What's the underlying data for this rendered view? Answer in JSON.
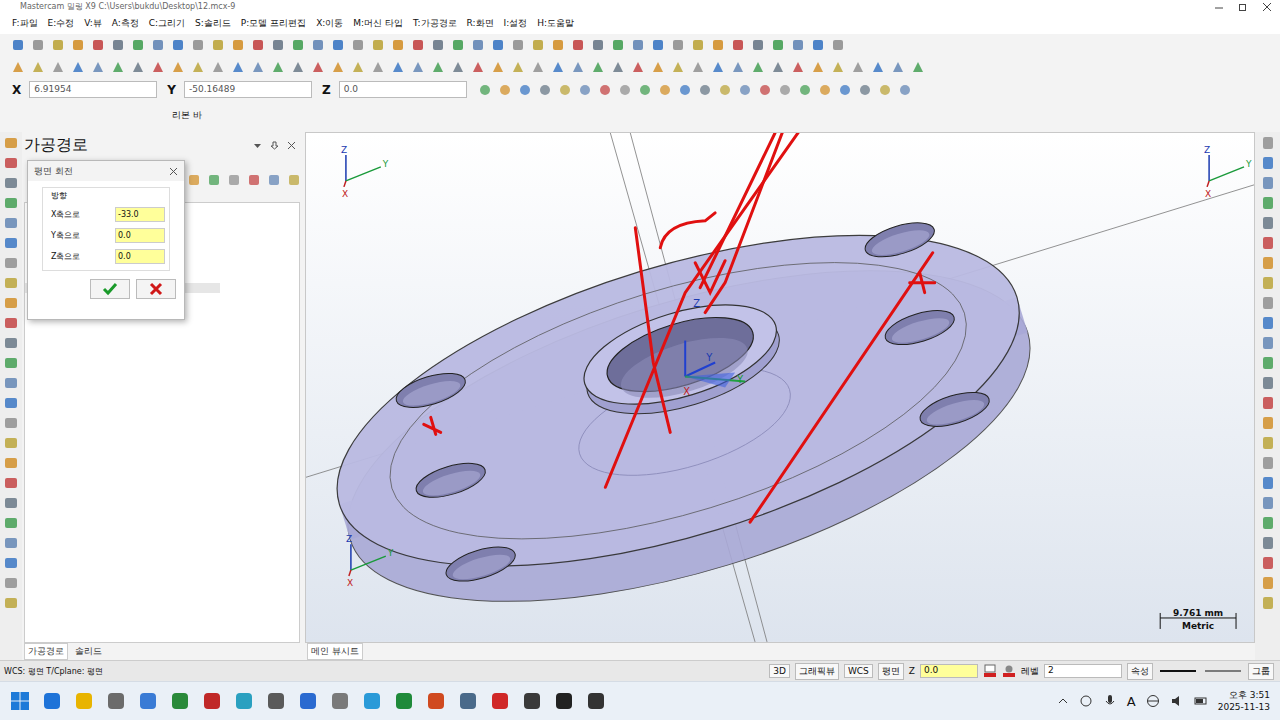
{
  "window": {
    "title": "Mastercam 밀링 X9  C:\\Users\\bukdu\\Desktop\\12.mcx-9"
  },
  "menu": [
    "F:파일",
    "E:수정",
    "V:뷰",
    "A:측정",
    "C:그리기",
    "S:솔리드",
    "P:모델 프리편집",
    "X:이동",
    "M:머신 타입",
    "T:가공경로",
    "R:화면",
    "I:설정",
    "H:도움말"
  ],
  "coords": [
    {
      "axis": "X",
      "value": "6.91954"
    },
    {
      "axis": "Y",
      "value": "-50.16489"
    },
    {
      "axis": "Z",
      "value": "0.0"
    }
  ],
  "ribbon_label": "리본 바",
  "panel": {
    "title": "가공경로",
    "tabs": [
      {
        "label": "가공경로",
        "selected": true
      },
      {
        "label": "솔리드",
        "selected": false
      }
    ]
  },
  "dialog": {
    "title": "평면 회전",
    "group": "방향",
    "fields": [
      {
        "label": "X축으로",
        "value": "-33.0"
      },
      {
        "label": "Y축으로",
        "value": "0.0"
      },
      {
        "label": "Z축으로",
        "value": "0.0"
      }
    ]
  },
  "viewport": {
    "tab": "메인 뷰시트",
    "axes": [
      "Z",
      "Y",
      "X"
    ],
    "scale": {
      "value": "9.761 mm",
      "unit": "Metric"
    }
  },
  "status_bar": {
    "left": "WCS: 평면 T/Cplane: 평면",
    "items": [
      "3D",
      "그래픽뷰",
      "WCS",
      "평면"
    ],
    "z_label": "Z",
    "z_value": "0.0",
    "level_label": "레벨",
    "level_value": "2",
    "attr": "속성",
    "group": "그룹"
  },
  "taskbar": {
    "ime": "A",
    "time": "오후 3:51",
    "date": "2025-11-13"
  }
}
